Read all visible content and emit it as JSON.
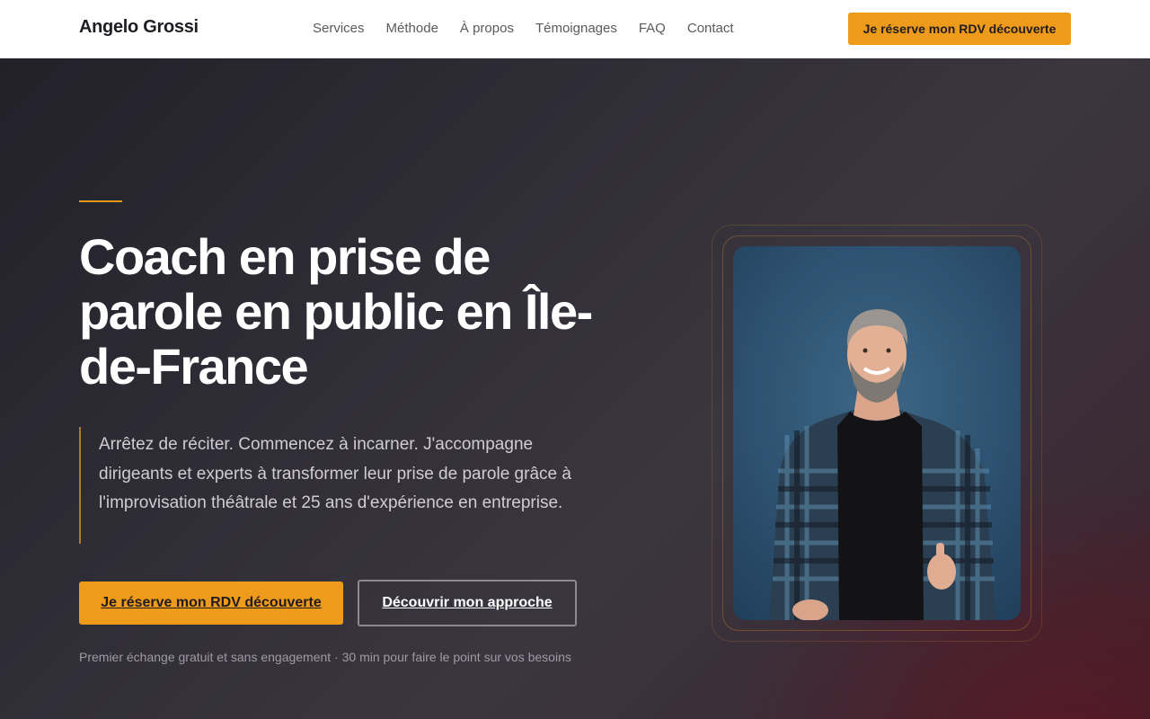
{
  "header": {
    "logo": "Angelo Grossi",
    "nav": [
      "Services",
      "Méthode",
      "À propos",
      "Témoignages",
      "FAQ",
      "Contact"
    ],
    "cta": "Je réserve mon RDV découverte"
  },
  "hero": {
    "title": "Coach en prise de parole en public en Île-de-France",
    "intro": "Arrêtez de réciter. Commencez à incarner. J'accompagne dirigeants et experts à transformer leur prise de parole grâce à l'improvisation théâtrale et 25 ans d'expérience en entreprise.",
    "primary_cta": "Je réserve mon RDV découverte",
    "secondary_cta": "Découvrir mon approche",
    "note": "Premier échange gratuit et sans engagement · 30 min pour faire le point sur vos besoins"
  },
  "colors": {
    "accent": "#ee9a1a",
    "hero_dark": "#26232b",
    "hero_burgundy": "#4a1c28"
  }
}
